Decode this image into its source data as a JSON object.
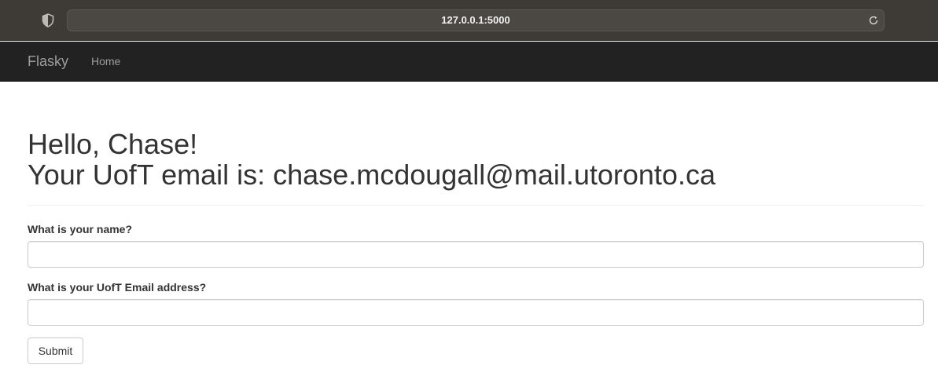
{
  "browser": {
    "url": "127.0.0.1:5000"
  },
  "navbar": {
    "brand": "Flasky",
    "items": [
      {
        "label": "Home"
      }
    ]
  },
  "header": {
    "greeting": "Hello, Chase!",
    "email_line": "Your UofT email is: chase.mcdougall@mail.utoronto.ca"
  },
  "form": {
    "name_label": "What is your name?",
    "name_value": "",
    "email_label": "What is your UofT Email address?",
    "email_value": "",
    "submit_label": "Submit"
  },
  "colors": {
    "browser_chrome": "#3e3a36",
    "navbar_bg": "#222222",
    "navbar_text": "#9d9d9d",
    "body_text": "#333333"
  }
}
